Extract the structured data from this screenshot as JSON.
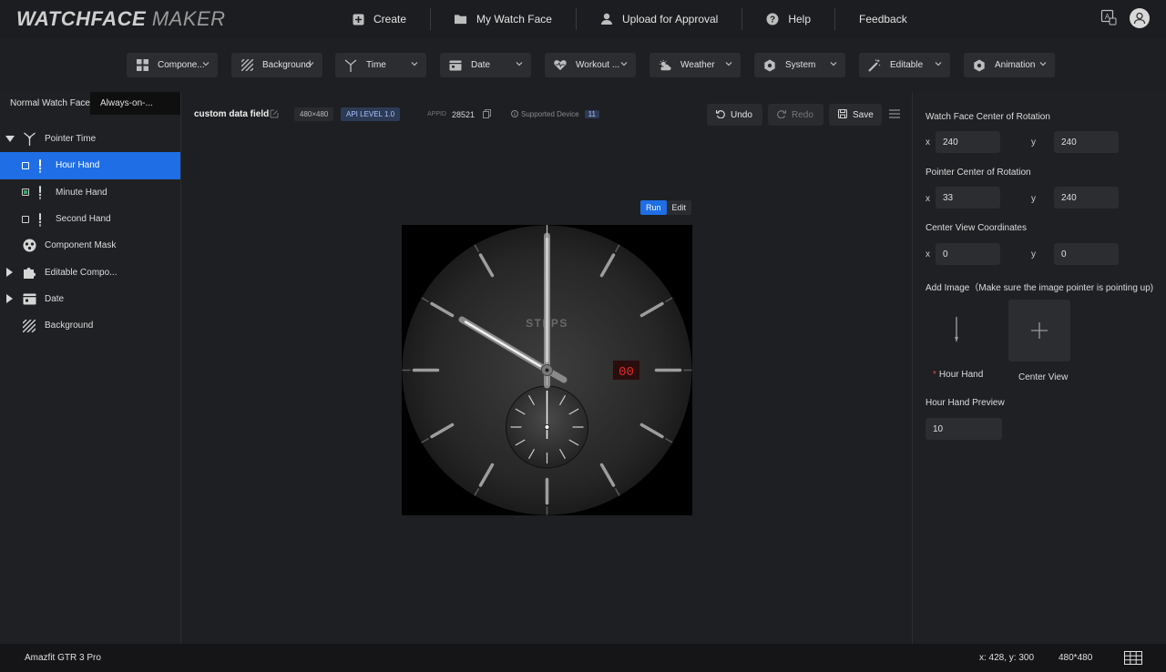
{
  "app": {
    "logo_bold": "WATCHFACE",
    "logo_thin": " MAKER"
  },
  "nav": {
    "items": [
      {
        "label": "Create",
        "icon": "plus-square-icon"
      },
      {
        "label": "My Watch Face",
        "icon": "folder-icon"
      },
      {
        "label": "Upload for Approval",
        "icon": "user-upload-icon"
      },
      {
        "label": "Help",
        "icon": "help-icon"
      },
      {
        "label": "Feedback",
        "icon": ""
      }
    ]
  },
  "toolbar": {
    "items": [
      {
        "label": "Compone...",
        "icon": "grid-icon"
      },
      {
        "label": "Background",
        "icon": "hatch-icon"
      },
      {
        "label": "Time",
        "icon": "pointer-icon"
      },
      {
        "label": "Date",
        "icon": "calendar-icon"
      },
      {
        "label": "Workout ...",
        "icon": "heart-icon"
      },
      {
        "label": "Weather",
        "icon": "weather-icon"
      },
      {
        "label": "System",
        "icon": "hex-icon"
      },
      {
        "label": "Editable",
        "icon": "wand-icon"
      },
      {
        "label": "Animation",
        "icon": "hex-icon"
      }
    ]
  },
  "left": {
    "tabs": [
      "Normal Watch Face",
      "Always-on-..."
    ],
    "tree": [
      {
        "label": "Pointer Time",
        "icon": "pointer-time-icon",
        "expanded": true
      },
      {
        "label": "Hour Hand",
        "selected": true
      },
      {
        "label": "Minute Hand"
      },
      {
        "label": "Second Hand"
      },
      {
        "label": "Component Mask",
        "icon": "mask-icon"
      },
      {
        "label": "Editable Compo...",
        "icon": "puzzle-icon"
      },
      {
        "label": "Date",
        "icon": "calendar-icon"
      },
      {
        "label": "Background",
        "icon": "hatch-icon"
      }
    ]
  },
  "center": {
    "field_name": "custom data field",
    "resolution": "480×480",
    "api_level": "API LEVEL 1.0",
    "appid_label": "APPID",
    "appid_value": "28521",
    "supported_label": "Supported Device",
    "supported_count": "11",
    "undo": "Undo",
    "redo": "Redo",
    "save": "Save",
    "run": "Run",
    "edit": "Edit",
    "watch": {
      "label": "STEPS",
      "digital": "00"
    }
  },
  "right": {
    "sections": [
      {
        "title": "Watch Face Center of Rotation",
        "x": "240",
        "y": "240"
      },
      {
        "title": "Pointer Center of Rotation",
        "x": "33",
        "y": "240"
      },
      {
        "title": "Center View Coordinates",
        "x": "0",
        "y": "0"
      }
    ],
    "x_label": "x",
    "y_label": "y",
    "add_image_title": "Add Image（Make sure the image pointer is pointing up)",
    "hour_hand_caption": "Hour Hand",
    "center_view_caption": "Center View",
    "preview_title": "Hour Hand Preview",
    "preview_value": "10"
  },
  "status": {
    "device": "Amazfit GTR 3 Pro",
    "coords": "x: 428, y: 300",
    "size": "480*480"
  }
}
